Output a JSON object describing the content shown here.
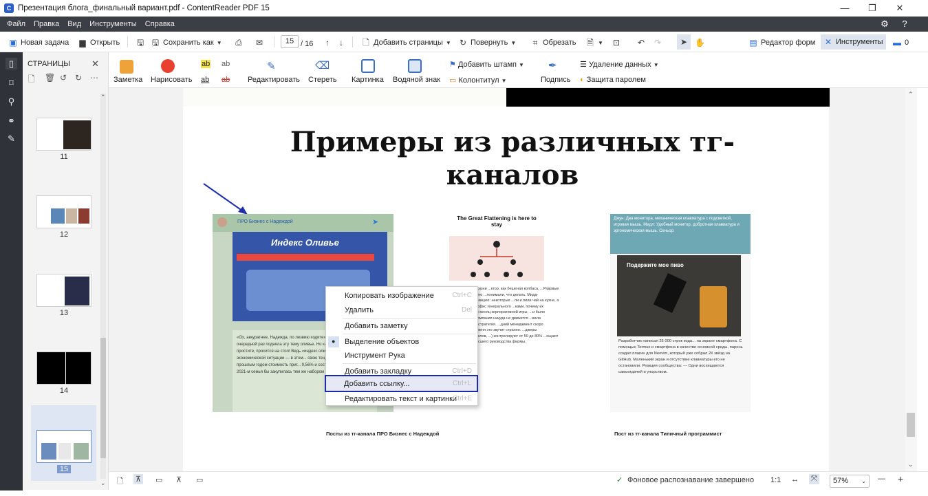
{
  "window": {
    "title": "Презентация блога_финальный вариант.pdf - ContentReader PDF 15",
    "app_icon": "C",
    "minimize": "—",
    "maximize": "❐",
    "close": "✕"
  },
  "menu": {
    "items": [
      "Файл",
      "Правка",
      "Вид",
      "Инструменты",
      "Справка"
    ],
    "settings_icon": "gear-icon",
    "help_icon": "help-icon"
  },
  "toolbar": {
    "new_task": "Новая задача",
    "open": "Открыть",
    "save_as": "Сохранить как",
    "page_current": "15",
    "page_total": "/ 16",
    "add_pages": "Добавить страницы",
    "rotate": "Повернуть",
    "crop": "Обрезать",
    "form_editor": "Редактор форм",
    "tools": "Инструменты",
    "comments_count": "0"
  },
  "pages_panel": {
    "title": "СТРАНИЦЫ",
    "close": "✕",
    "thumbnails": [
      {
        "label": "11"
      },
      {
        "label": "12"
      },
      {
        "label": "13"
      },
      {
        "label": "14"
      },
      {
        "label": "15"
      }
    ]
  },
  "ribbon": {
    "note": "Заметка",
    "draw": "Нарисовать",
    "edit": "Редактировать",
    "erase": "Стереть",
    "picture": "Картинка",
    "watermark": "Водяной знак",
    "add_stamp": "Добавить штамп",
    "header_footer": "Колонтитул",
    "signature": "Подпись",
    "remove_data": "Удаление данных",
    "password": "Защита паролем",
    "ab1": "ab",
    "ab2": "ab",
    "ab3": "ab",
    "ab4": "ab"
  },
  "slide": {
    "title": "Примеры из различных тг-каналов",
    "img1_channel": "ПРО Бизнес с Надеждой",
    "img1_banner": "Индекс Оливье",
    "img1_text": "«Ох, аккуратнее, Надежда, по лезвию ходите». Я услышала я, когда в очередной раз подняла эту тему оливье. Но как ее обойти, если... простите, просится на стол! Ведь «индекс оливье» — самый... экономической ситуации — в этом... свою тенденцию к увеличению... прошлым годом стоимость приг... 9,56% и составила 501 рубль в сре... 2021-м семья бы закупилась тем же набором",
    "img2_title": "The Great Flattening is here to stay",
    "img2_text": "...ров офисной жизни ...ктор, как бешеная колбаса, ...Рядовые сотрудники нервно ...понимали, что делать. Мидд- ...интересную позицию: некоторые ...ли и пили чай на кухне, а то время ...сь в офис генерального ...ками, почему их игнорируют. ...ой месяц корпоративной игры, ...и было понятно, что ...компания никуда не движется ...вала революционная стратегия. ...дний менеджмент скоро исчезнет ...Для меня это звучит странно. ...джеры (начальники отделов, ...) контролируют от 50 до 80% ...ощают в жизнь идеи высшего руководства фирмы.",
    "img3_head": "Джун: Два монитора, механическая клавиатура с подсветкой, игровая мышь. Мидл: Удобный монитор, добротная клавиатура и эргономическая мышь. Сеньор:",
    "img3_photo_text": "Подержите мое пиво",
    "img3_text": "Разработчик написал 25 000 строк кода... на экране смартфона. С помощью Termux и смартфона в качестве основной среды, парень создал плагин для Neovim, который уже собрал 2К звёзд на GitHub. Маленький экран и отсутствие клавиатуры его не остановили. Реакция сообщества: — Одни восхищаются самоотдачей и упорством.",
    "caption1": "Посты из тг-канала ПРО Бизнес с Надеждой",
    "caption2": "Пост из тг-канала Типичный программист"
  },
  "context_menu": {
    "items": [
      {
        "label": "Копировать изображение",
        "shortcut": "Ctrl+C"
      },
      {
        "label": "Удалить",
        "shortcut": "Del"
      },
      {
        "label": "Добавить заметку",
        "shortcut": ""
      },
      {
        "label": "Выделение объектов",
        "shortcut": ""
      },
      {
        "label": "Инструмент Рука",
        "shortcut": ""
      },
      {
        "label": "Добавить закладку",
        "shortcut": "Ctrl+D"
      },
      {
        "label": "Добавить ссылку...",
        "shortcut": "Ctrl+L"
      },
      {
        "label": "Редактировать текст и картинки",
        "shortcut": "Ctrl+E"
      }
    ],
    "checked_item": "Выделение объектов",
    "highlighted_item": "Добавить ссылку..."
  },
  "status": {
    "ocr": "Фоновое распознавание завершено",
    "ratio": "1:1",
    "zoom": "57%",
    "minus": "—",
    "plus": "+"
  },
  "colors": {
    "menubar": "#3b3e45",
    "leftrail": "#2f3339",
    "highlight_border": "#1c2aa6",
    "accent": "#2b6cd4"
  }
}
